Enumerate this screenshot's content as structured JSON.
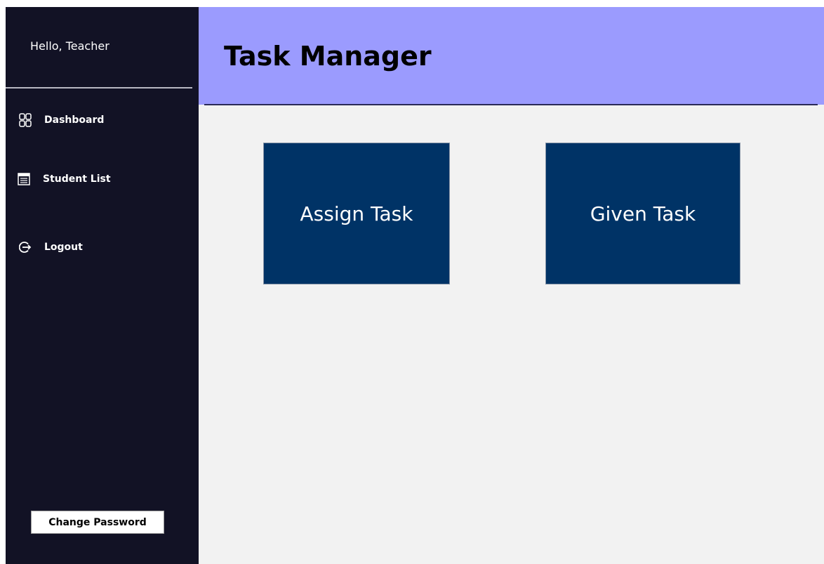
{
  "sidebar": {
    "greeting": "Hello, Teacher",
    "nav": [
      {
        "label": "Dashboard",
        "icon": "grid-icon"
      },
      {
        "label": "Student List",
        "icon": "list-icon"
      },
      {
        "label": "Logout",
        "icon": "logout-icon"
      }
    ],
    "change_password_label": "Change Password"
  },
  "header": {
    "title": "Task Manager"
  },
  "main": {
    "tiles": [
      {
        "label": "Assign Task"
      },
      {
        "label": "Given Task"
      }
    ]
  },
  "colors": {
    "sidebar_bg": "#121225",
    "header_bg": "#9b9bfe",
    "tile_bg": "#003366",
    "content_bg": "#f2f2f2"
  }
}
